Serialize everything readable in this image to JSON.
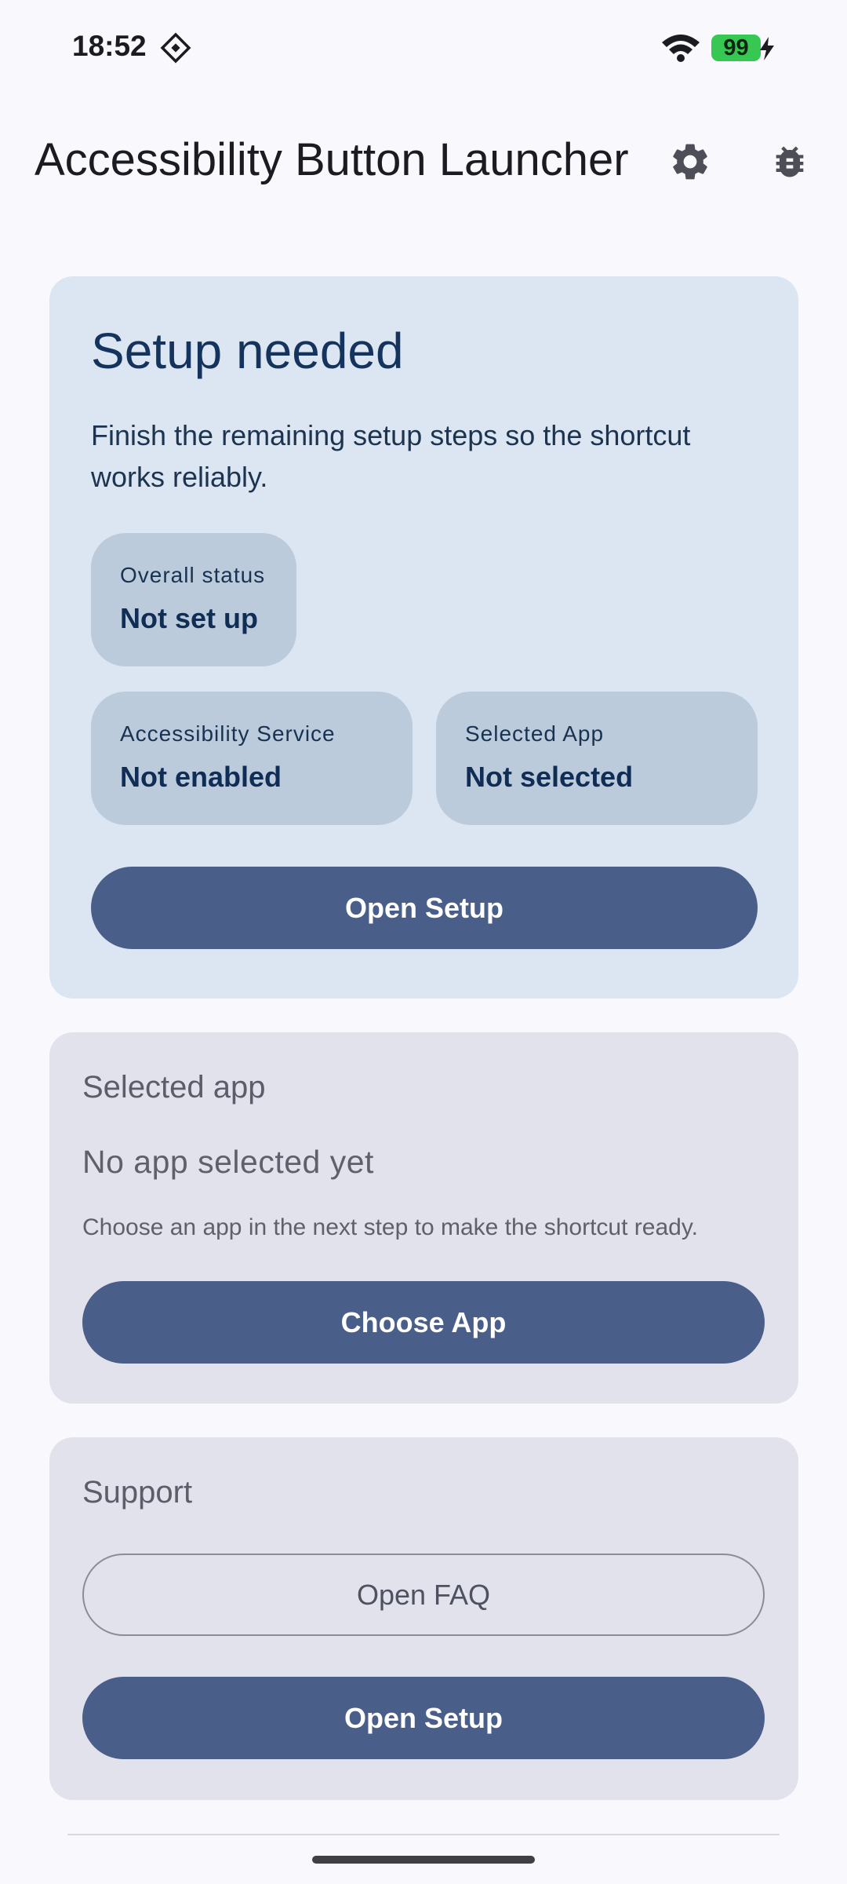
{
  "status_bar": {
    "time": "18:52",
    "battery_level": "99",
    "icons": [
      "notification-icon",
      "wifi-icon",
      "battery-icon",
      "charging-bolt-icon"
    ]
  },
  "app_bar": {
    "title": "Accessibility Button Launcher",
    "actions": [
      "settings-gear-icon",
      "bug-icon"
    ]
  },
  "setup_card": {
    "title": "Setup needed",
    "description": "Finish the remaining setup steps so the shortcut works reliably.",
    "overall_status": {
      "label": "Overall status",
      "value": "Not set up"
    },
    "accessibility_service": {
      "label": "Accessibility Service",
      "value": "Not enabled"
    },
    "selected_app": {
      "label": "Selected App",
      "value": "Not selected"
    },
    "button_label": "Open Setup"
  },
  "selected_app_card": {
    "title": "Selected app",
    "empty_text": "No app selected yet",
    "hint": "Choose an app in the next step to make the shortcut ready.",
    "button_label": "Choose App"
  },
  "support_card": {
    "title": "Support",
    "faq_button_label": "Open FAQ",
    "setup_button_label": "Open Setup"
  },
  "colors": {
    "background": "#f8f8fd",
    "setup_card": "#dce6f2",
    "chip": "#bccbdb",
    "neutral_card": "#e2e2ec",
    "primary_button": "#4a5e8a",
    "battery": "#37c853"
  }
}
